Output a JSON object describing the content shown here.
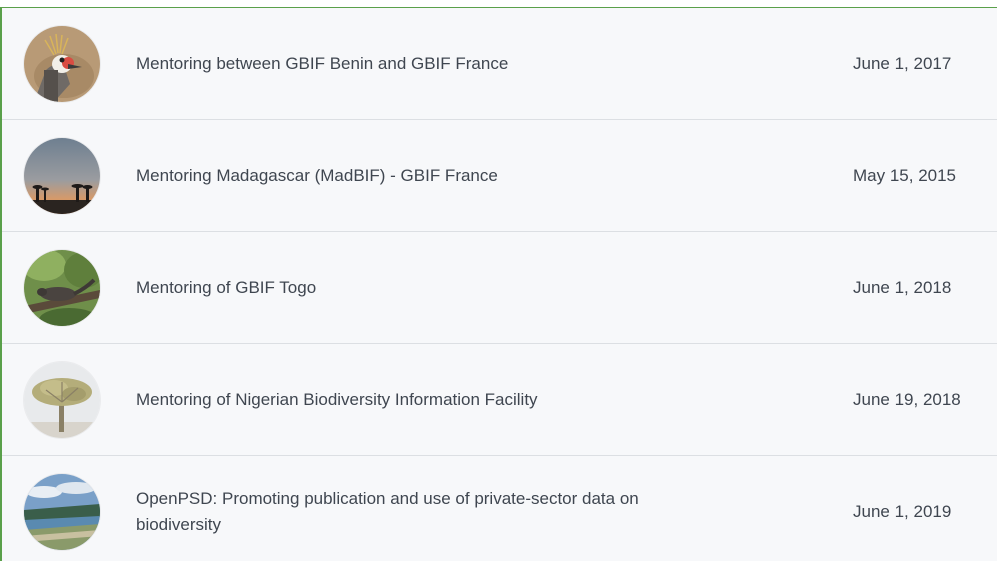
{
  "projects": [
    {
      "title": "Mentoring between GBIF Benin and GBIF France",
      "date": "June 1, 2017",
      "thumbnail": "crowned-crane-photo"
    },
    {
      "title": "Mentoring Madagascar (MadBIF) - GBIF France",
      "date": "May 15, 2015",
      "thumbnail": "baobab-sunset-photo"
    },
    {
      "title": "Mentoring of GBIF Togo",
      "date": "June 1, 2018",
      "thumbnail": "squirrel-on-branch-photo"
    },
    {
      "title": "Mentoring of Nigerian Biodiversity Information Facility",
      "date": "June 19, 2018",
      "thumbnail": "tree-photo"
    },
    {
      "title": "OpenPSD: Promoting publication and use of private-sector data on biodiversity",
      "date": "June 1, 2019",
      "thumbnail": "coastal-landscape-photo"
    }
  ]
}
